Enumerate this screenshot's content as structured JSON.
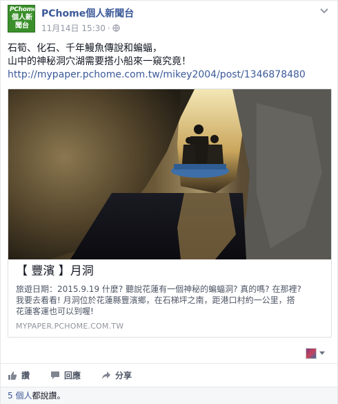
{
  "header": {
    "avatar_brand": "PChome",
    "avatar_brand_cn": "個人新聞台",
    "page_name": "PChome個人新聞台",
    "timestamp": "11月14日 15:30",
    "separator": "·"
  },
  "post": {
    "text_line1": "石筍、化石、千年鰻魚傳說和蝙蝠，",
    "text_line2": "山中的神秘洞穴湖需要搭小船來一窺究竟！",
    "link": "http://mypaper.pchome.com.tw/mikey2004/post/1346878480"
  },
  "card": {
    "title": "【 豐濱 】月洞",
    "desc_line1": "旅遊日期：2015.9.19 什麼? 聽說花蓮有一個神秘的蝙蝠洞? 真的嗎? 在那裡?",
    "desc_line2": "我要去看看! 月洞位於花蓮縣豐濱鄉，在石梯坪之南，距港口村約一公里，搭",
    "desc_line3": "花蓮客運也可以到喔!",
    "domain": "MYPAPER.PCHOME.COM.TW"
  },
  "actions": {
    "like": "讚",
    "comment": "回應",
    "share": "分享"
  },
  "likes": {
    "count": "5 個人",
    "rest": "都說讚。"
  },
  "colors": {
    "link_blue": "#3b5998",
    "meta_gray": "#9197a3",
    "brand_green": "#3a8f2a"
  },
  "icons": [
    "globe-icon",
    "chevron-down-icon",
    "thumbs-up-icon",
    "comment-icon",
    "share-icon"
  ]
}
